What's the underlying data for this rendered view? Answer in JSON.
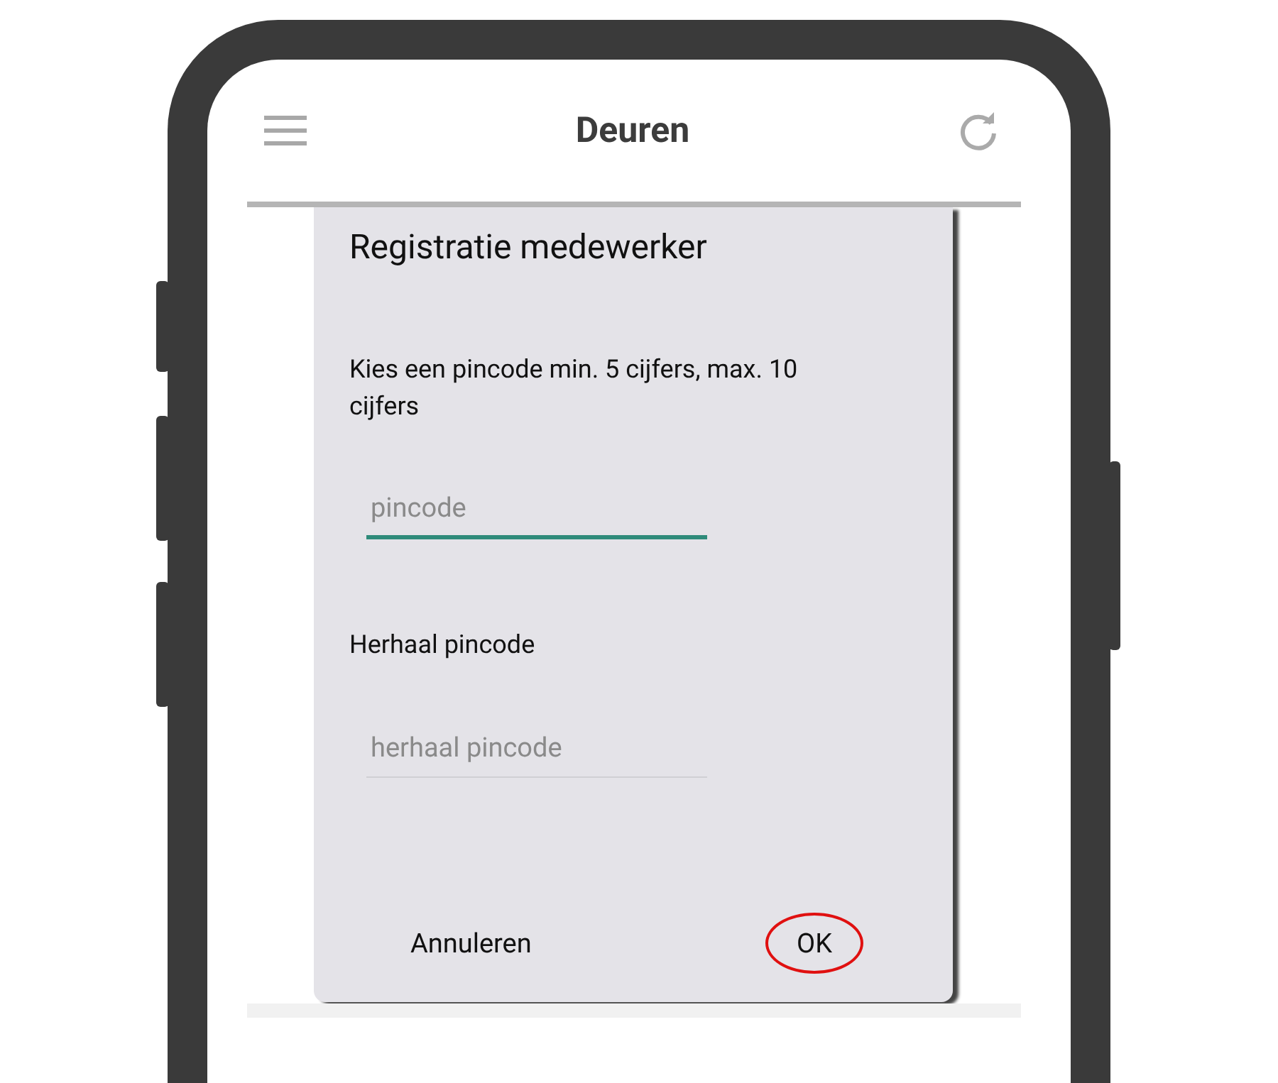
{
  "app_bar": {
    "title": "Deuren"
  },
  "dialog": {
    "title": "Registratie medewerker",
    "fields": [
      {
        "label": "Kies een pincode min. 5 cijfers, max. 10 cijfers",
        "placeholder": "pincode",
        "focused": true
      },
      {
        "label": "Herhaal pincode",
        "placeholder": "herhaal pincode",
        "focused": false
      }
    ],
    "buttons": [
      {
        "label": "Annuleren",
        "highlighted": false
      },
      {
        "label": "OK",
        "highlighted": true
      }
    ]
  }
}
